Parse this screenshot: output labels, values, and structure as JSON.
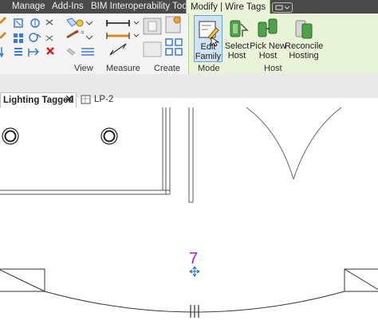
{
  "ribbon_tabs": [
    "Manage",
    "Add-Ins",
    "BIM Interoperability Tools",
    "Modify | Wire Tags"
  ],
  "panels": {
    "view": "View",
    "measure": "Measure",
    "create": "Create",
    "mode": "Mode",
    "host": "Host"
  },
  "buttons": {
    "edit_family_line1": "Edit",
    "edit_family_line2": "Family",
    "select_host_line1": "Select",
    "select_host_line2": "Host",
    "pick_new_host_line1": "Pick New",
    "pick_new_host_line2": "Host",
    "reconcile_hosting_line1": "Reconcile",
    "reconcile_hosting_line2": "Hosting"
  },
  "view_tabs": [
    {
      "label": "Lighting Tagged",
      "active": true
    },
    {
      "label": "LP-2",
      "active": false
    }
  ],
  "tag_value": "7",
  "colors": {
    "accent": "#b31cc4",
    "tab_bar": "#4a4a4a",
    "contextual_tab": "#eaf5dc"
  }
}
